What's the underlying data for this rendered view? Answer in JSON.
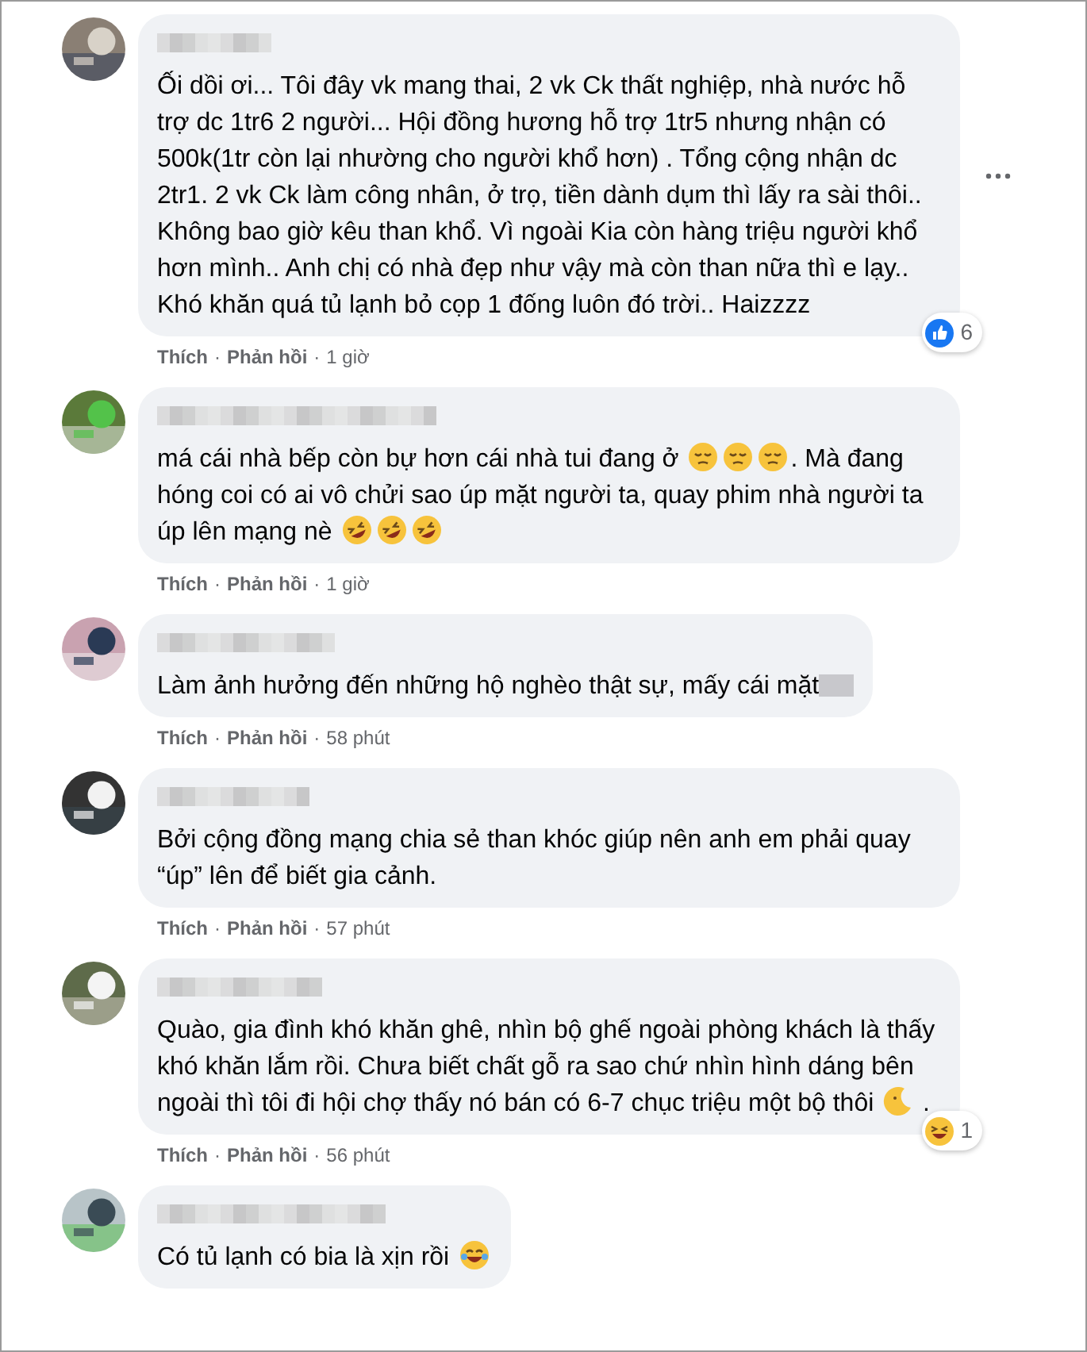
{
  "comments": [
    {
      "avatar": {
        "kind": "picture"
      },
      "body": [
        {
          "kind": "text",
          "text": "Ối dồi ơi... Tôi đây vk mang thai, 2 vk Ck thất nghiệp, nhà nước hỗ trợ dc 1tr6 2 người... Hội đồng hương hỗ trợ 1tr5 nhưng nhận có 500k(1tr còn lại nhường cho người khổ hơn) . Tổng cộng nhận dc 2tr1. 2 vk Ck làm công nhân, ở trọ, tiền dành dụm thì lấy ra sài thôi.. Không bao giờ kêu than khổ. Vì ngoài Kia còn hàng triệu người khổ hơn mình.. Anh chị có nhà đẹp như vậy mà còn than nữa thì e lạy.. Khó khăn quá tủ lạnh bỏ cọp 1 đống luôn đó trời.. Haizzzz"
        }
      ],
      "like": "Thích",
      "dot_1": "·",
      "reply": "Phản hồi",
      "dot_2": "·",
      "time": "1 giờ",
      "reaction": {
        "kind": "like",
        "count": "6"
      },
      "menu": true
    },
    {
      "avatar": {
        "kind": "picture"
      },
      "body": [
        {
          "kind": "text",
          "text": "má cái nhà bếp còn bự hơn cái nhà tui đang ở "
        },
        {
          "kind": "pensive"
        },
        {
          "kind": "pensive"
        },
        {
          "kind": "pensive"
        },
        {
          "kind": "text",
          "text": ". Mà đang hóng coi có ai vô chửi sao úp mặt người ta, quay phim nhà người ta úp lên mạng nè "
        },
        {
          "kind": "rofl"
        },
        {
          "kind": "rofl"
        },
        {
          "kind": "rofl"
        }
      ],
      "like": "Thích",
      "dot_1": "·",
      "reply": "Phản hồi",
      "dot_2": "·",
      "time": "1 giờ",
      "menu": false
    },
    {
      "avatar": {
        "kind": "picture"
      },
      "body": [
        {
          "kind": "text",
          "text": "Làm ảnh hưởng đến những hộ nghèo thật sự, mấy cái mặt"
        },
        {
          "kind": "blur"
        }
      ],
      "like": "Thích",
      "dot_1": "·",
      "reply": "Phản hồi",
      "dot_2": "·",
      "time": "58 phút",
      "menu": false
    },
    {
      "avatar": {
        "kind": "picture"
      },
      "body": [
        {
          "kind": "text",
          "text": "Bởi cộng đồng mạng chia sẻ than khóc giúp nên anh em phải quay “úp” lên để biết gia cảnh."
        }
      ],
      "like": "Thích",
      "dot_1": "·",
      "reply": "Phản hồi",
      "dot_2": "·",
      "time": "57 phút",
      "menu": false
    },
    {
      "avatar": {
        "kind": "picture"
      },
      "body": [
        {
          "kind": "text",
          "text": "Quào, gia đình khó khăn ghê, nhìn bộ ghế ngoài phòng khách là thấy khó khăn lắm rồi. Chưa biết chất gỗ ra sao chứ nhìn hình dáng bên ngoài thì tôi đi hội chợ thấy nó bán có 6-7 chục triệu một bộ thôi "
        },
        {
          "kind": "moon"
        },
        {
          "kind": "text",
          "text": " ."
        }
      ],
      "like": "Thích",
      "dot_1": "·",
      "reply": "Phản hồi",
      "dot_2": "·",
      "time": "56 phút",
      "reaction": {
        "kind": "haha",
        "count": "1"
      },
      "menu": false
    },
    {
      "avatar": {
        "kind": "picture"
      },
      "body": [
        {
          "kind": "text",
          "text": "Có tủ lạnh có bia là xịn rồi "
        },
        {
          "kind": "joy"
        }
      ],
      "menu": false
    }
  ]
}
